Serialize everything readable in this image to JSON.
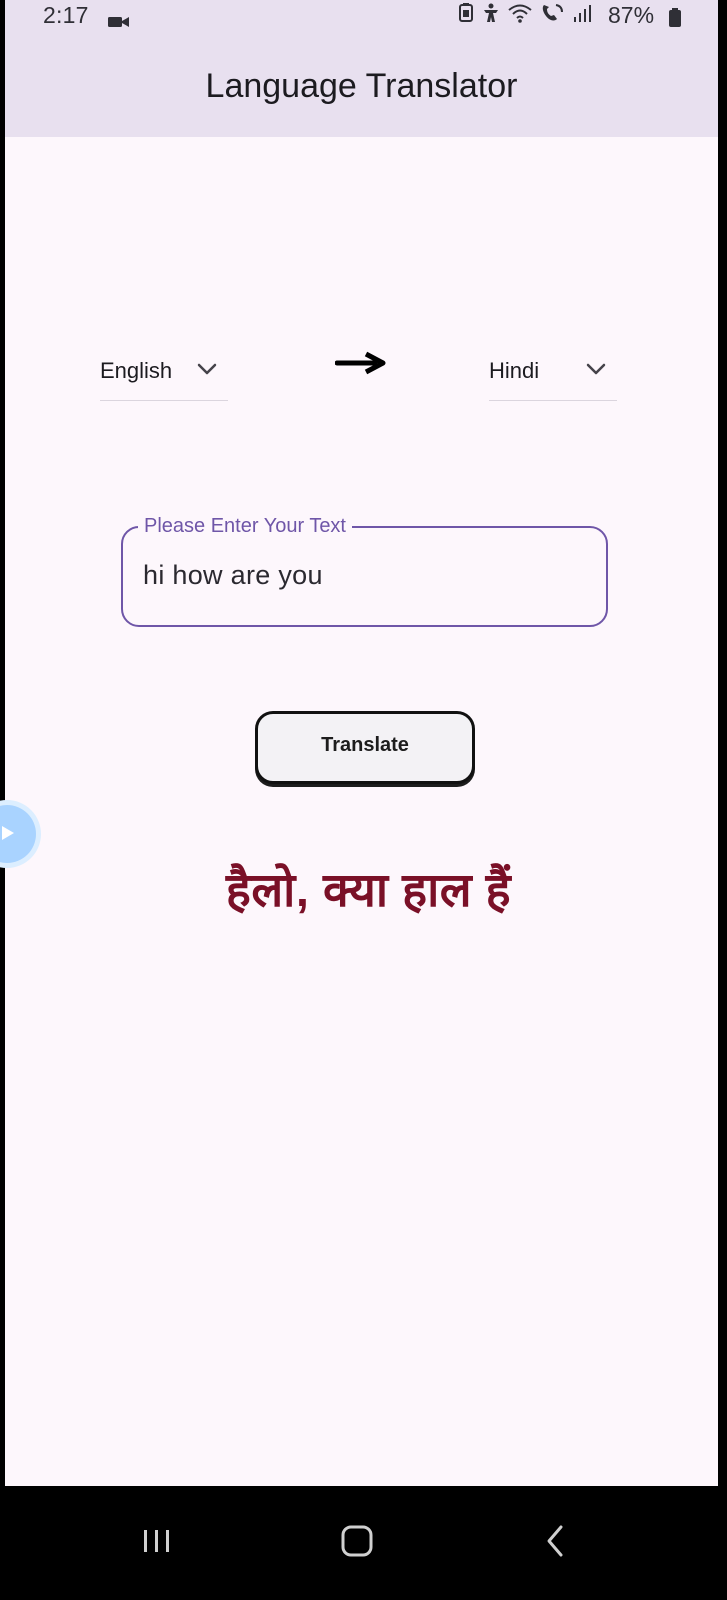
{
  "status_bar": {
    "time": "2:17",
    "battery_percent": "87%",
    "icons": [
      "video-icon",
      "battery-saver-icon",
      "accessibility-icon",
      "wifi-icon",
      "call-icon",
      "signal-icon",
      "battery-icon"
    ]
  },
  "app_bar": {
    "title": "Language Translator"
  },
  "language_selector": {
    "source": "English",
    "target": "Hindi",
    "arrow_icon": "arrow-right-icon",
    "chevron_icon": "chevron-down-icon"
  },
  "input": {
    "label": "Please Enter Your Text",
    "value": "hi how are you"
  },
  "action": {
    "translate_label": "Translate"
  },
  "result": {
    "text": "हैलो, क्या हाल हैं"
  },
  "colors": {
    "app_bar": "#e8e0ef",
    "background": "#fdf7fc",
    "accent": "#6f56a8",
    "result_text": "#7a1027"
  }
}
